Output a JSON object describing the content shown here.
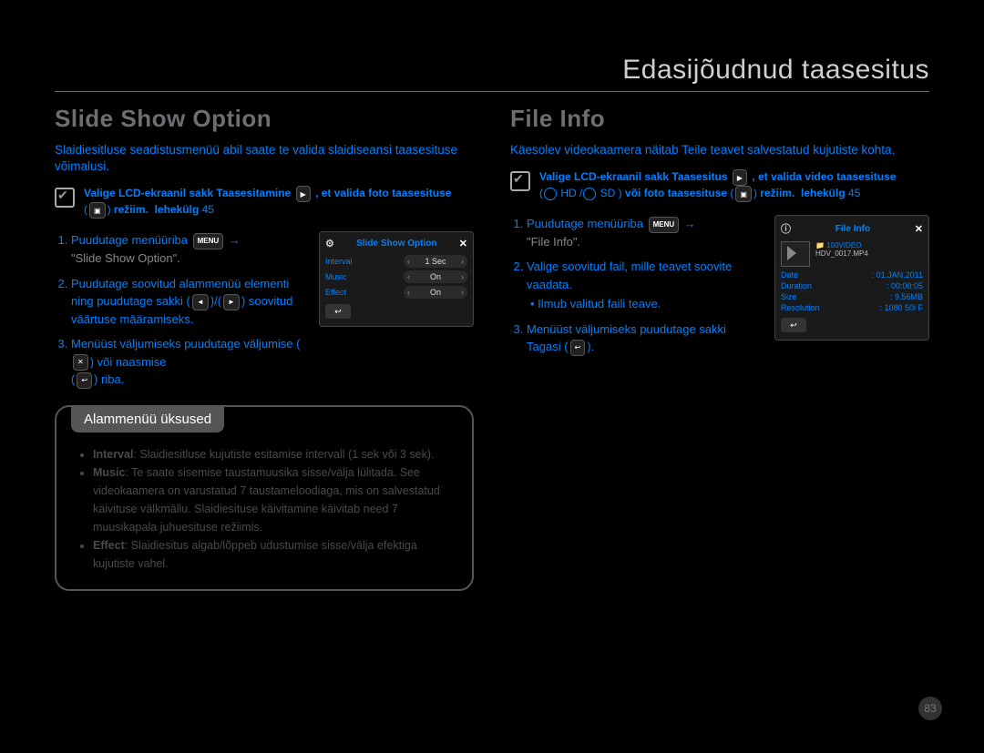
{
  "chapter": "Edasijõudnud taasesitus",
  "pageNumber": "83",
  "left": {
    "heading": "Slide Show Option",
    "intro": "Slaidiesitluse seadistusmenüü abil saate te valida slaidiseansi taasesituse võimalusi.",
    "precheck_line1": "Valige LCD-ekraanil sakk Taasesitamine",
    "precheck_line2": ", et valida foto taasesituse",
    "precheck_line3": "režiim.",
    "precheck_pageref_label": "lehekülg",
    "precheck_pageref_num": "45",
    "step1a": "Puudutage menüüriba",
    "step1_arrow": "→",
    "step1b": "\"Slide Show Option\".",
    "step2": "Puudutage soovitud alammenüü elementi ning puudutage sakki",
    "step2_suffix": "soovitud väärtuse määramiseks.",
    "step3a": "Menüüst väljumiseks puudutage väljumise",
    "step3b": "või naasmise",
    "step3c": "riba.",
    "device": {
      "title": "Slide Show Option",
      "rows": [
        {
          "label": "Interval",
          "value": "1 Sec"
        },
        {
          "label": "Music",
          "value": "On"
        },
        {
          "label": "Effect",
          "value": "On"
        }
      ]
    },
    "submenu": {
      "title": "Alammenüü üksused",
      "items": [
        {
          "bold": "Interval",
          "rest": ": Slaidiesitluse kujutiste esitamise intervall (1 sek või 3 sek)."
        },
        {
          "bold": "Music",
          "rest": ": Te saate sisemise taustamuusika sisse/välja lülitada. See videokaamera on varustatud 7 taustameloodiaga, mis on salvestatud käivituse välkmällu. Slaidiesituse käivitamine käivitab need 7 muusikapala juhuesituse režiimis."
        },
        {
          "bold": "Effect",
          "rest": ": Slaidiesitus algab/lõppeb udustumise sisse/välja efektiga kujutiste vahel."
        }
      ]
    }
  },
  "right": {
    "heading": "File Info",
    "intro": "Käesolev videokaamera näitab Teile teavet salvestatud kujutiste kohta.",
    "precheck_line1": "Valige LCD-ekraanil sakk Taasesitus",
    "precheck_line2": ", et valida video taasesituse",
    "precheck_modes": "HD / SD",
    "precheck_line3": "või foto taasesituse",
    "precheck_line4": "režiim.",
    "precheck_pageref_label": "lehekülg",
    "precheck_pageref_num": "45",
    "step1a": "Puudutage menüüriba",
    "step1_arrow": "→",
    "step1b": "\"File Info\".",
    "step2": "Valige soovitud fail, mille teavet soovite vaadata.",
    "step2_bullet": "Ilmub valitud faili teave.",
    "step3a": "Menüüst väljumiseks puudutage sakki Tagasi",
    "device": {
      "title": "File Info",
      "folder": "100VIDEO",
      "filename": "HDV_0017.MP4",
      "info": [
        {
          "k": "Date",
          "v": "01.JAN.2011"
        },
        {
          "k": "Duration",
          "v": "00:00:05"
        },
        {
          "k": "Size",
          "v": "9.56MB"
        },
        {
          "k": "Resolution",
          "v": "1080 50i F"
        }
      ]
    }
  }
}
